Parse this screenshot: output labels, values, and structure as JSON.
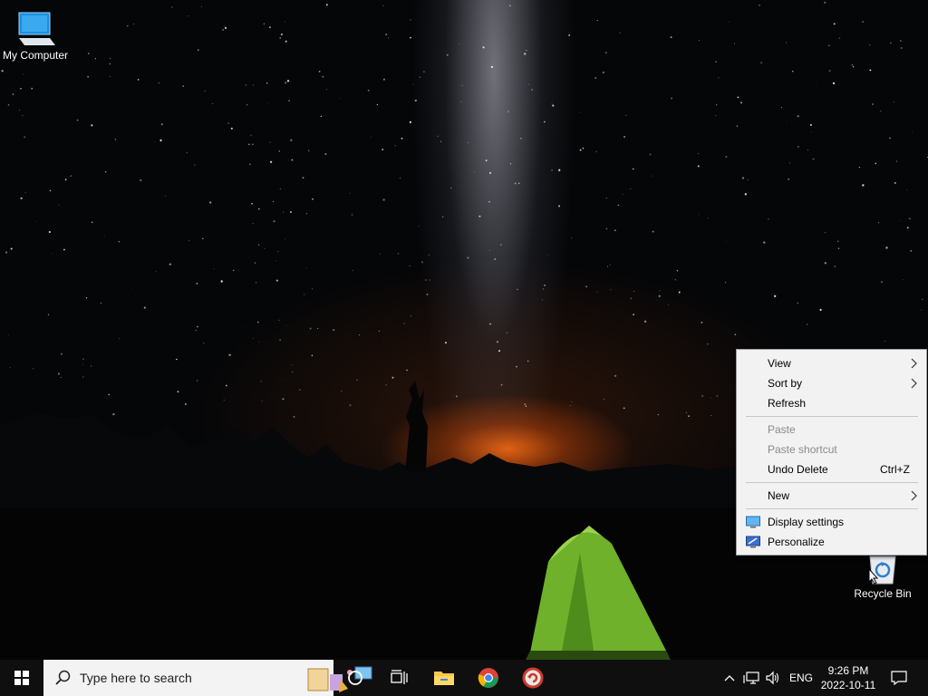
{
  "desktop": {
    "icons": [
      {
        "label": "My Computer"
      },
      {
        "label": "Recycle Bin"
      }
    ]
  },
  "context_menu": {
    "items": [
      {
        "label": "View",
        "submenu": true
      },
      {
        "label": "Sort by",
        "submenu": true
      },
      {
        "label": "Refresh"
      },
      {
        "label": "Paste",
        "disabled": true
      },
      {
        "label": "Paste shortcut",
        "disabled": true
      },
      {
        "label": "Undo Delete",
        "shortcut": "Ctrl+Z"
      },
      {
        "label": "New",
        "submenu": true
      },
      {
        "label": "Display settings",
        "icon": "display-icon"
      },
      {
        "label": "Personalize",
        "icon": "personalize-icon"
      }
    ]
  },
  "taskbar": {
    "search_placeholder": "Type here to search",
    "apps": [
      "file-explorer-icon",
      "chrome-icon",
      "app-icon"
    ],
    "tray": {
      "language": "ENG",
      "time": "9:26 PM",
      "date": "2022-10-11"
    }
  }
}
